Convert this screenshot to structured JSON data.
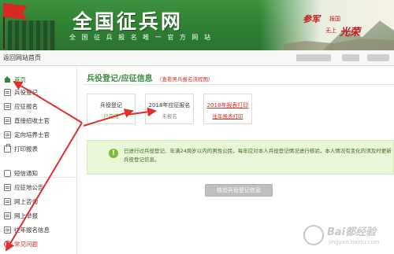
{
  "header": {
    "logo_title": "全国征兵网",
    "logo_subtitle": "全 国 征 兵 报 名 唯 一 官 方 网 站",
    "slogan_line1": "参军",
    "slogan_small1": "报国",
    "slogan_line2": "光荣",
    "slogan_small2": "无上",
    "colors": {
      "banner": "#2f7f32",
      "slogan": "#c8181e"
    }
  },
  "topbar": {
    "back_label": "返回网站首页"
  },
  "sidebar": {
    "items": [
      {
        "label": "首页",
        "icon": "home-icon",
        "state": "active"
      },
      {
        "label": "兵役登记",
        "icon": "document-icon"
      },
      {
        "label": "应征报名",
        "icon": "document-icon"
      },
      {
        "label": "直接招收士官",
        "icon": "document-icon"
      },
      {
        "label": "定向培养士官",
        "icon": "document-icon"
      },
      {
        "label": "打印报表",
        "icon": "printer-icon"
      },
      {
        "label": "短信通知",
        "icon": "chat-icon"
      },
      {
        "label": "应征地公告",
        "icon": "document-icon"
      },
      {
        "label": "网上咨询",
        "icon": "document-icon"
      },
      {
        "label": "网上举报",
        "icon": "document-icon"
      },
      {
        "label": "往年报名信息",
        "icon": "document-icon"
      },
      {
        "label": "常见问题",
        "icon": "question-icon",
        "state": "highlight"
      }
    ]
  },
  "main": {
    "title": "兵役登记/应征信息",
    "flow_link": "（查看男兵报名流程图）",
    "cards": [
      {
        "line1": "兵役登记",
        "line2": "已完成",
        "line2_color": "#5aa84a"
      },
      {
        "line1": "2018年应征报名",
        "line2": "未报名",
        "line2_color": "#888888"
      },
      {
        "line1": "2018年报表打印",
        "line2": "往年报表打印",
        "line2_color": "#d0302a",
        "line1_color": "#d0302a"
      }
    ],
    "notice": "已进行过兵役登记、年满24周岁以内的男性公民，每年应对本人兵役登记情况进行核验，本人情况有变化的须及时更新兵役登记信息。",
    "verify_button": "核验兵役登记信息"
  },
  "watermark": {
    "brand": "Bai都经验",
    "url": "jingyan.baidu.com"
  },
  "colors": {
    "accent_green": "#3a8f3f",
    "notice_bg": "#eaf6d8",
    "arrow_red": "#e0302a"
  }
}
